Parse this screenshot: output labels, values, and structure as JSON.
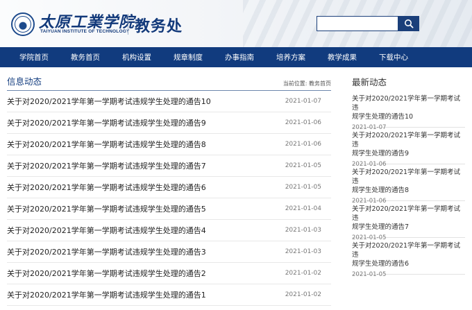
{
  "header": {
    "school_name_cn": "太原工業学院",
    "school_name_en": "TAIYUAN INSTITUTE OF TECHNOLOGY",
    "department": "教务处",
    "search": {
      "placeholder": "",
      "value": ""
    }
  },
  "nav": {
    "items": [
      "学院首页",
      "教务首页",
      "机构设置",
      "规章制度",
      "办事指南",
      "培养方案",
      "教学成果",
      "下载中心"
    ]
  },
  "left": {
    "section_title": "信息动态",
    "breadcrumb": "当前位置: 教务首页",
    "news": [
      {
        "title": "关于对2020/2021学年第一学期考试违规学生处理的通告10",
        "date": "2021-01-07"
      },
      {
        "title": "关于对2020/2021学年第一学期考试违规学生处理的通告9",
        "date": "2021-01-06"
      },
      {
        "title": "关于对2020/2021学年第一学期考试违规学生处理的通告8",
        "date": "2021-01-06"
      },
      {
        "title": "关于对2020/2021学年第一学期考试违规学生处理的通告7",
        "date": "2021-01-05"
      },
      {
        "title": "关于对2020/2021学年第一学期考试违规学生处理的通告6",
        "date": "2021-01-05"
      },
      {
        "title": "关于对2020/2021学年第一学期考试违规学生处理的通告5",
        "date": "2021-01-04"
      },
      {
        "title": "关于对2020/2021学年第一学期考试违规学生处理的通告4",
        "date": "2021-01-03"
      },
      {
        "title": "关于对2020/2021学年第一学期考试违规学生处理的通告3",
        "date": "2021-01-03"
      },
      {
        "title": "关于对2020/2021学年第一学期考试违规学生处理的通告2",
        "date": "2021-01-02"
      },
      {
        "title": "关于对2020/2021学年第一学期考试违规学生处理的通告1",
        "date": "2021-01-02"
      }
    ]
  },
  "right": {
    "section_title": "最新动态",
    "items": [
      {
        "title_line1": "关于对2020/2021学年第一学期考试违",
        "title_line2": "规学生处理的通告10",
        "date": "2021-01-07"
      },
      {
        "title_line1": "关于对2020/2021学年第一学期考试违",
        "title_line2": "规学生处理的通告9",
        "date": "2021-01-06"
      },
      {
        "title_line1": "关于对2020/2021学年第一学期考试违",
        "title_line2": "规学生处理的通告8",
        "date": "2021-01-06"
      },
      {
        "title_line1": "关于对2020/2021学年第一学期考试违",
        "title_line2": "规学生处理的通告7",
        "date": "2021-01-05"
      },
      {
        "title_line1": "关于对2020/2021学年第一学期考试违",
        "title_line2": "规学生处理的通告6",
        "date": "2021-01-05"
      }
    ]
  },
  "icons": {
    "search": "search-icon",
    "logo": "school-emblem-icon"
  },
  "colors": {
    "brand_blue": "#113b7e",
    "nav_bg": "#113b7e",
    "search_btn": "#1b3f7a"
  }
}
